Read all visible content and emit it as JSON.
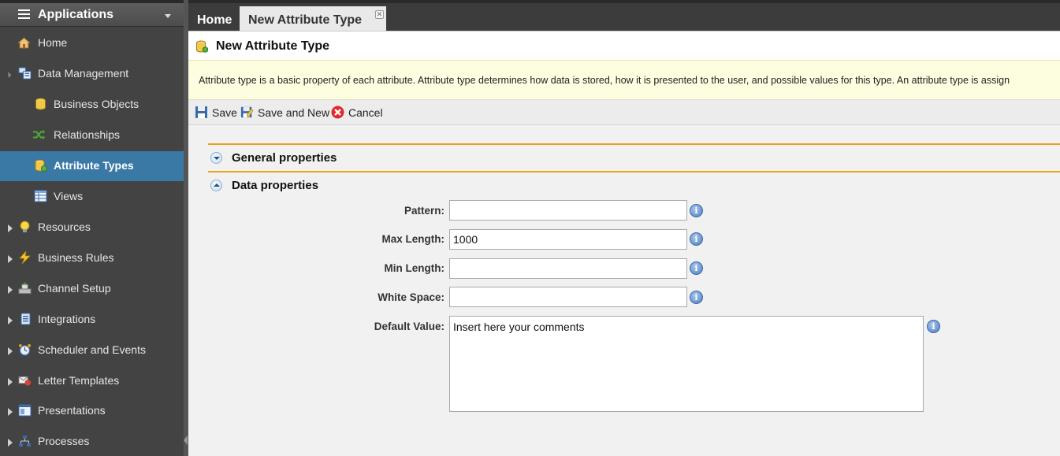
{
  "sidebar": {
    "title": "Applications",
    "items": [
      {
        "label": "Home"
      },
      {
        "label": "Data Management"
      },
      {
        "label": "Business Objects"
      },
      {
        "label": "Relationships"
      },
      {
        "label": "Attribute Types"
      },
      {
        "label": "Views"
      },
      {
        "label": "Resources"
      },
      {
        "label": "Business Rules"
      },
      {
        "label": "Channel Setup"
      },
      {
        "label": "Integrations"
      },
      {
        "label": "Scheduler and Events"
      },
      {
        "label": "Letter Templates"
      },
      {
        "label": "Presentations"
      },
      {
        "label": "Processes"
      }
    ]
  },
  "tabs": {
    "home": "Home",
    "current": "New Attribute Type",
    "close_glyph": "✕"
  },
  "page": {
    "title": "New Attribute Type",
    "description": "Attribute type is a basic property of each attribute. Attribute type determines how data is stored, how it is presented to the user, and possible values for this type. An attribute type is assign"
  },
  "toolbar": {
    "save": "Save",
    "save_and_new": "Save and New",
    "cancel": "Cancel"
  },
  "sections": {
    "general": "General properties",
    "data": "Data properties"
  },
  "form": {
    "pattern": {
      "label": "Pattern:",
      "value": ""
    },
    "max_length": {
      "label": "Max Length:",
      "value": "1000"
    },
    "min_length": {
      "label": "Min Length:",
      "value": ""
    },
    "white_space": {
      "label": "White Space:",
      "value": ""
    },
    "default_value": {
      "label": "Default Value:",
      "value": "Insert here your comments"
    },
    "info_glyph": "i"
  },
  "colors": {
    "selected": "#3a78a6",
    "section_rule": "#e8a317",
    "info_bar": "#fdfde0"
  }
}
